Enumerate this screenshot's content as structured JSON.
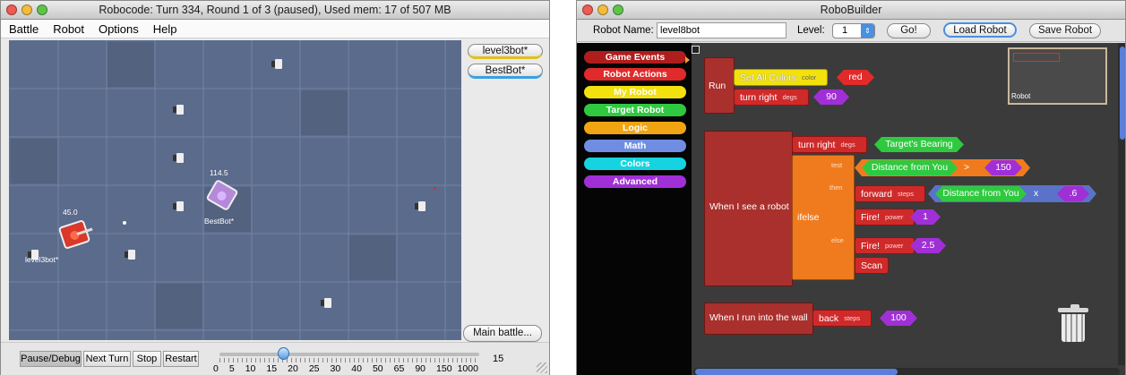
{
  "robocode": {
    "title": "Robocode: Turn 334, Round 1 of 3 (paused), Used mem: 17 of 507 MB",
    "menu": [
      "Battle",
      "Robot",
      "Options",
      "Help"
    ],
    "robot_buttons": [
      "level3bot*",
      "BestBot*"
    ],
    "main_battle_button": "Main battle...",
    "controls": [
      "Pause/Debug",
      "Next Turn",
      "Stop",
      "Restart"
    ],
    "slider": {
      "value": "15",
      "ticks": [
        "0",
        "5",
        "10",
        "15",
        "20",
        "25",
        "30",
        "40",
        "50",
        "65",
        "90",
        "150",
        "1000"
      ]
    },
    "robots": [
      {
        "name": "level3bot*",
        "energy": "45.0",
        "color": "#d9382a"
      },
      {
        "name": "BestBot*",
        "energy": "114.5",
        "color": "#b48ad8"
      }
    ],
    "arena_color": "#5b6b8c"
  },
  "robobuilder": {
    "title": "RoboBuilder",
    "robot_name_label": "Robot Name:",
    "robot_name_value": "level8bot",
    "level_label": "Level:",
    "level_value": "1",
    "go_button": "Go!",
    "load_button": "Load Robot",
    "save_button": "Save Robot",
    "categories": [
      {
        "label": "Game Events",
        "color": "#b01d1d"
      },
      {
        "label": "Robot Actions",
        "color": "#e12a2a"
      },
      {
        "label": "My Robot",
        "color": "#f2e10c"
      },
      {
        "label": "Target Robot",
        "color": "#2fc940"
      },
      {
        "label": "Logic",
        "color": "#f0a412"
      },
      {
        "label": "Math",
        "color": "#6f8ee3"
      },
      {
        "label": "Colors",
        "color": "#15d3e0"
      },
      {
        "label": "Advanced",
        "color": "#a12fd6"
      }
    ],
    "preview_label": "Robot",
    "blocks": {
      "run": "Run",
      "set_all_colors": "Set All Colors",
      "color_param": "color",
      "color_value": "red",
      "turn_right": "turn right",
      "degs": "degs",
      "turn_value": "90",
      "when_see": "When I see a robot",
      "targets_bearing": "Target's Bearing",
      "ifelse": "ifelse",
      "test": "test",
      "then": "then",
      "else": "else",
      "distance_from_you": "Distance from You",
      "gt": ">",
      "threshold": "150",
      "forward": "forward",
      "steps": "steps",
      "times": "x",
      "factor": ".6",
      "fire": "Fire!",
      "power": "power",
      "fire_then": "1",
      "fire_else": "2.5",
      "scan": "Scan",
      "when_wall": "When I run into the wall",
      "back": "back",
      "back_value": "100"
    }
  }
}
